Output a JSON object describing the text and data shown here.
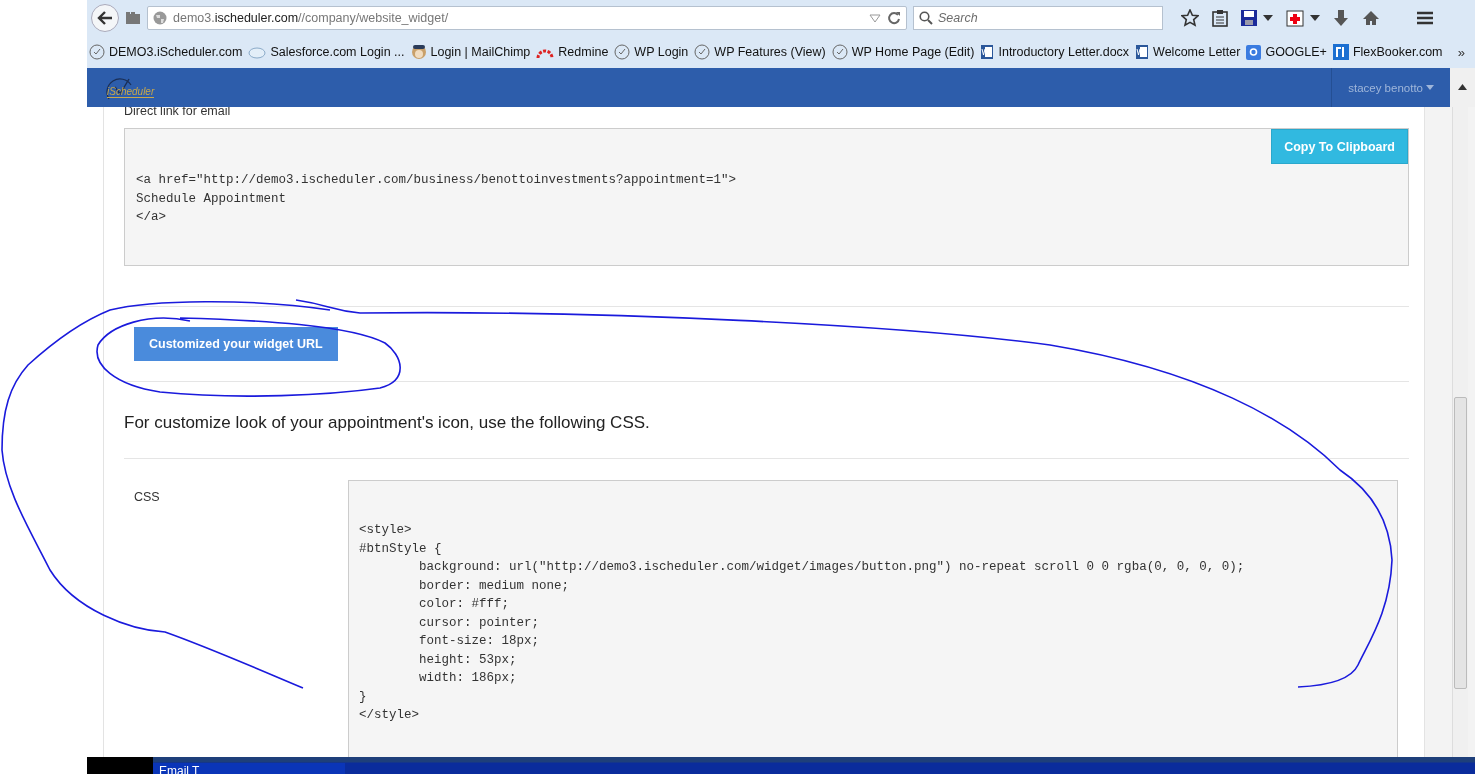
{
  "browser": {
    "url": {
      "prefix": "demo3.",
      "host": "ischeduler.com",
      "path": "//company/website_widget/"
    },
    "search": {
      "placeholder": "Search"
    },
    "bookmarks": [
      {
        "label": "DEMO3.iScheduler.com",
        "kind": "clock"
      },
      {
        "label": "Salesforce.com Login ...",
        "kind": "cloud"
      },
      {
        "label": "Login | MailChimp",
        "kind": "face"
      },
      {
        "label": "Redmine",
        "kind": "arc"
      },
      {
        "label": "WP Login",
        "kind": "clock"
      },
      {
        "label": "WP Features (View)",
        "kind": "clock"
      },
      {
        "label": "WP Home Page (Edit)",
        "kind": "clock"
      },
      {
        "label": "Introductory Letter.docx",
        "kind": "doc"
      },
      {
        "label": "Welcome Letter",
        "kind": "doc"
      },
      {
        "label": "GOOGLE+",
        "kind": "tile"
      },
      {
        "label": "FlexBooker.com",
        "kind": "square"
      }
    ],
    "overflow": "»"
  },
  "app_header": {
    "logo": "iScheduler",
    "user": "stacey benotto"
  },
  "content": {
    "direct_link_label": "Direct link for email",
    "copy_button": "Copy To Clipboard",
    "email_code": [
      "<a href=\"http://demo3.ischeduler.com/business/benottoinvestments?appointment=1\">",
      "Schedule Appointment",
      "</a>"
    ],
    "customize_button": "Customized your widget URL",
    "css_heading": "For customize look of your appointment's icon, use the following CSS.",
    "css_label": "CSS",
    "css_code": [
      "<style>",
      "#btnStyle {",
      "        background: url(\"http://demo3.ischeduler.com/widget/images/button.png\") no-repeat scroll 0 0 rgba(0, 0, 0, 0);",
      "        border: medium none;",
      "        color: #fff;",
      "        cursor: pointer;",
      "        font-size: 18px;",
      "        height: 53px;",
      "        width: 186px;",
      "}",
      "</style>"
    ]
  },
  "taskbar": {
    "item": "Email T"
  }
}
